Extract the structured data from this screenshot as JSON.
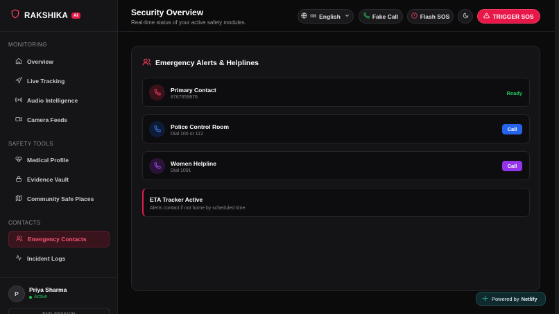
{
  "brand": {
    "name": "RAKSHIKA",
    "badge": "AI"
  },
  "sidebar": {
    "sections": [
      {
        "label": "MONITORING",
        "items": [
          "Overview",
          "Live Tracking",
          "Audio Intelligence",
          "Camera Feeds"
        ]
      },
      {
        "label": "SAFETY TOOLS",
        "items": [
          "Medical Profile",
          "Evidence Vault",
          "Community Safe Places"
        ]
      },
      {
        "label": "CONTACTS",
        "items": [
          "Emergency Contacts",
          "Incident Logs"
        ]
      }
    ],
    "active_item": "Emergency Contacts"
  },
  "user": {
    "initial": "P",
    "name": "Priya Sharma",
    "status": "Active",
    "end_session": "END SESSION"
  },
  "header": {
    "title": "Security Overview",
    "subtitle": "Real-time status of your active safety modules.",
    "lang_flag": "GB",
    "language": "English",
    "fake_call": "Fake Call",
    "flash_sos": "Flash SOS",
    "trigger_sos": "TRIGGER SOS"
  },
  "card": {
    "title": "Emergency Alerts & Helplines",
    "contacts": [
      {
        "name": "Primary Contact",
        "sub": "8767659876",
        "status": "Ready"
      },
      {
        "name": "Police Control Room",
        "sub": "Dial 100 or 112",
        "action": "Call"
      },
      {
        "name": "Women Helpline",
        "sub": "Dial 1091",
        "action": "Call"
      }
    ],
    "eta": {
      "title": "ETA Tracker Active",
      "sub": "Alerts contact if not home by scheduled time."
    }
  },
  "netlify": {
    "prefix": "Powered by",
    "brand": "Netlify"
  },
  "colors": {
    "accent": "#e8174a",
    "ready": "#22c55e",
    "police_blue": "#2563eb",
    "helpline_purple": "#9333ea"
  }
}
